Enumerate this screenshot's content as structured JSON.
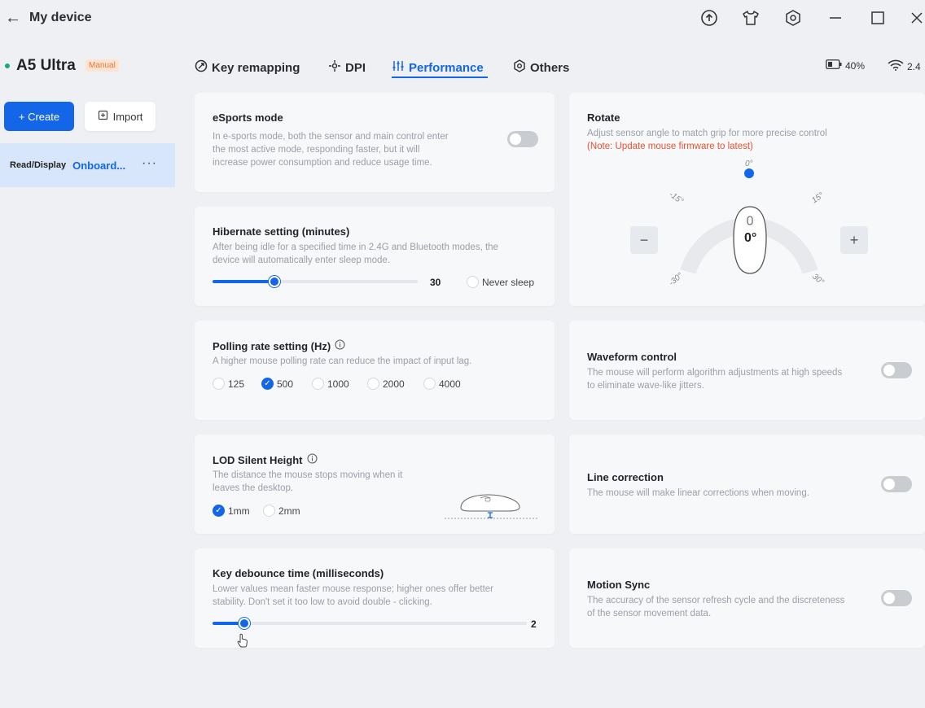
{
  "window": {
    "back_icon": "back-arrow-icon",
    "title": "My device",
    "icons": [
      "upload-icon",
      "shirt-icon",
      "settings-hex-icon",
      "minimize-icon",
      "maximize-icon",
      "close-icon"
    ]
  },
  "device": {
    "name": "A5 Ultra",
    "mode_badge": "Manual",
    "create_label": "+ Create",
    "import_label": "Import",
    "profile": {
      "access": "Read/Display",
      "name": "Onboard...",
      "more": "···"
    }
  },
  "tabs": [
    {
      "label": "Key remapping",
      "icon": "key-remap-icon",
      "active": false
    },
    {
      "label": "DPI",
      "icon": "dpi-crosshair-icon",
      "active": false
    },
    {
      "label": "Performance",
      "icon": "sliders-icon",
      "active": true
    },
    {
      "label": "Others",
      "icon": "gear-icon",
      "active": false
    }
  ],
  "status": {
    "battery": "40%",
    "battery_icon": "battery-icon",
    "connection": "2.4",
    "connection_icon": "wifi-icon"
  },
  "esports": {
    "title": "eSports mode",
    "desc1": "In e-sports mode, both the sensor and main control enter",
    "desc2": "the most  active mode, responding faster, but it will",
    "desc3": "increase power consumption and reduce usage time.",
    "enabled": false
  },
  "hibernate": {
    "title": "Hibernate setting (minutes)",
    "desc1": "After being idle for a specified time in 2.4G and Bluetooth modes, the",
    "desc2": "device will automatically enter sleep mode.",
    "value": "30",
    "fill": 0.3,
    "never_sleep": "Never sleep"
  },
  "polling": {
    "title": "Polling rate setting (Hz)",
    "desc": "A higher mouse polling rate can reduce the impact of input lag.",
    "options": [
      "125",
      "500",
      "1000",
      "2000",
      "4000"
    ],
    "selected": "500"
  },
  "lod": {
    "title": "LOD Silent Height",
    "desc1": "The distance the mouse stops moving when it",
    "desc2": "leaves the desktop.",
    "options": [
      "1mm",
      "2mm"
    ],
    "selected": "1mm"
  },
  "debounce": {
    "title": "Key debounce time (milliseconds)",
    "desc1": "Lower values mean faster mouse response; higher ones offer better",
    "desc2": "stability. Don't set it too low to avoid double - clicking.",
    "value": "2",
    "fill": 0.1
  },
  "rotate": {
    "title": "Rotate",
    "desc": "Adjust sensor angle to match grip for more precise control",
    "note": "(Note: Update mouse firmware to latest)",
    "angle": "0°",
    "ticks": {
      "top": "0°",
      "left15": "-15°",
      "right15": "15°",
      "left30": "-30°",
      "right30": "30°"
    },
    "minus": "−",
    "plus": "+"
  },
  "waveform": {
    "title": "Waveform control",
    "desc1": "The mouse will perform algorithm adjustments at high speeds",
    "desc2": "to eliminate wave-like jitters.",
    "enabled": false
  },
  "line": {
    "title": "Line correction",
    "desc": "The mouse will make linear corrections when moving.",
    "enabled": false
  },
  "motion": {
    "title": "Motion Sync",
    "desc1": "The accuracy of the sensor refresh cycle and the discreteness",
    "desc2": "of the sensor movement data.",
    "enabled": false
  }
}
